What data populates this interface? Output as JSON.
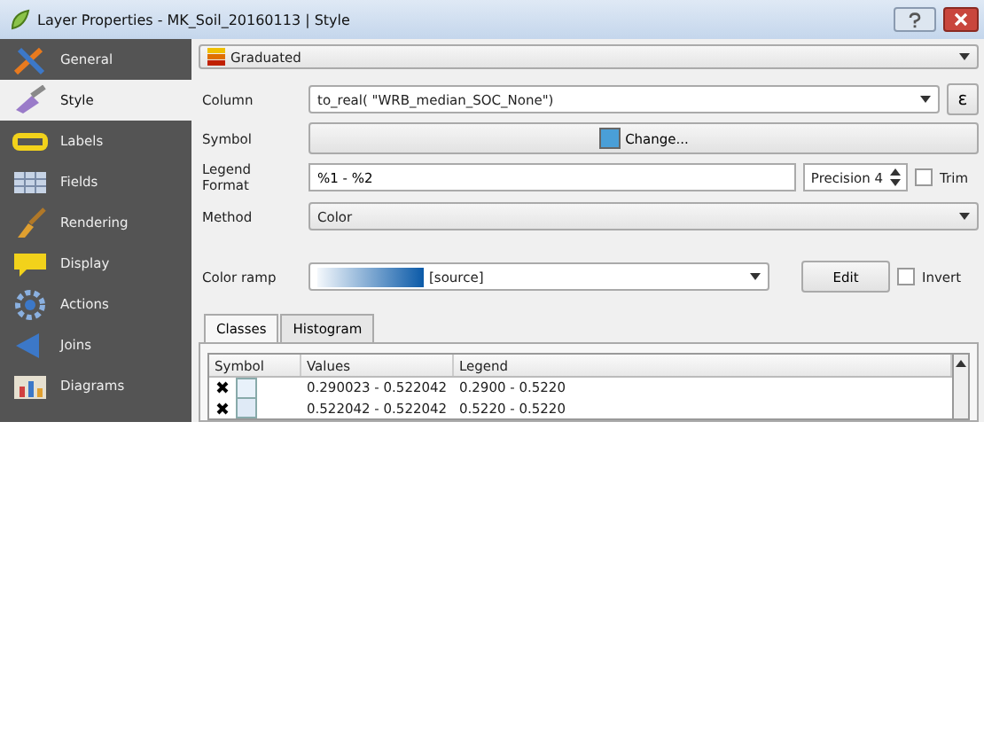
{
  "window": {
    "title": "Layer Properties - MK_Soil_20160113 | Style"
  },
  "sidebar": {
    "items": [
      {
        "label": "General",
        "kind": "tools",
        "selected": false
      },
      {
        "label": "Style",
        "kind": "brush",
        "selected": true
      },
      {
        "label": "Labels",
        "kind": "abc",
        "selected": false
      },
      {
        "label": "Fields",
        "kind": "table",
        "selected": false
      },
      {
        "label": "Rendering",
        "kind": "paint",
        "selected": false
      },
      {
        "label": "Display",
        "kind": "bubble",
        "selected": false
      },
      {
        "label": "Actions",
        "kind": "gear",
        "selected": false
      },
      {
        "label": "Joins",
        "kind": "join",
        "selected": false
      },
      {
        "label": "Diagrams",
        "kind": "chart",
        "selected": false
      }
    ]
  },
  "renderer": {
    "value": "Graduated"
  },
  "form": {
    "column_label": "Column",
    "column_value": "to_real( \"WRB_median_SOC_None\")",
    "expression_button": "ε",
    "symbol_label": "Symbol",
    "symbol_button": "Change...",
    "legend_label": "Legend Format",
    "legend_value": "%1 - %2",
    "precision": "Precision 4",
    "trim_label": "Trim",
    "trim_checked": false,
    "method_label": "Method",
    "method_value": "Color",
    "ramp_label": "Color ramp",
    "ramp_value": "[source]",
    "edit_button": "Edit",
    "invert_label": "Invert",
    "invert_checked": false
  },
  "tabs": [
    {
      "label": "Classes",
      "selected": true
    },
    {
      "label": "Histogram",
      "selected": false
    }
  ],
  "table": {
    "columns": [
      "Symbol",
      "Values",
      "Legend"
    ],
    "rows": [
      {
        "checked": true,
        "color": "#e8f1fa",
        "values": "0.290023 - 0.522042",
        "legend": "0.2900 - 0.5220"
      },
      {
        "checked": true,
        "color": "#dfeaf6",
        "values": "0.522042 - 0.522042",
        "legend": "0.5220 - 0.5220"
      }
    ]
  }
}
